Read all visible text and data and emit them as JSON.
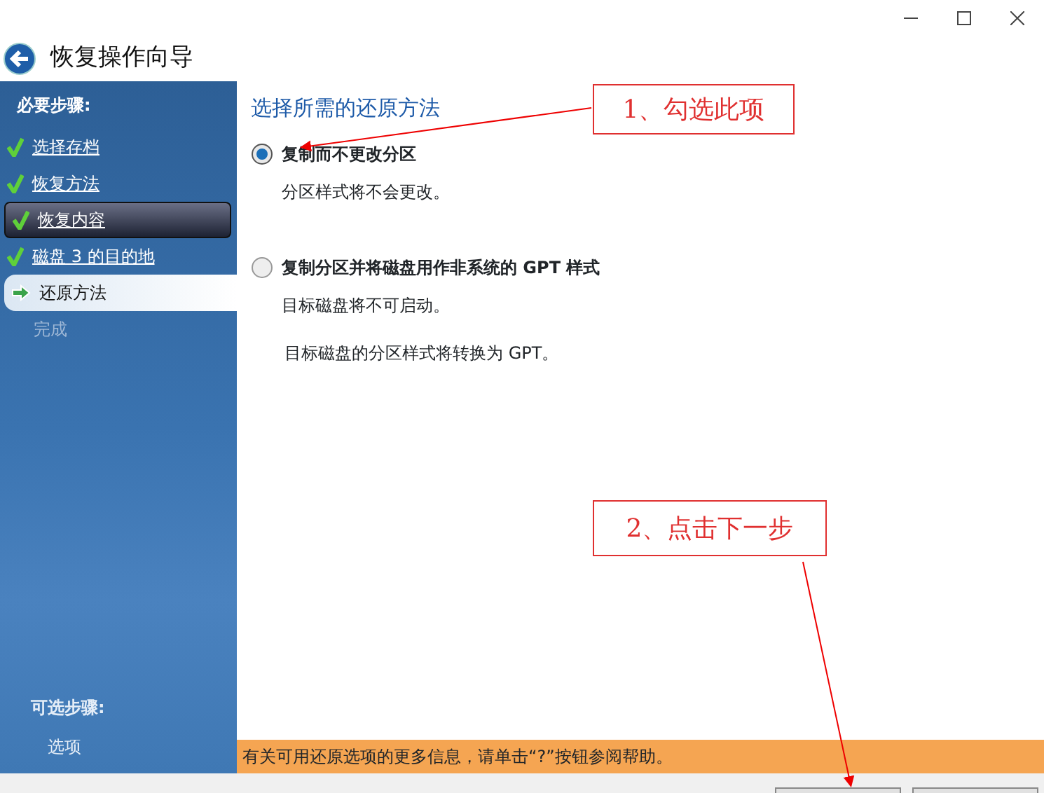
{
  "window": {
    "title": "恢复操作向导"
  },
  "sidebar": {
    "required_heading": "必要步骤:",
    "steps": [
      {
        "label": "选择存档",
        "kind": "done",
        "selected": false
      },
      {
        "label": "恢复方法",
        "kind": "done",
        "selected": false
      },
      {
        "label": "恢复内容",
        "kind": "done",
        "selected": true
      },
      {
        "label": " 磁盘 3 的目的地",
        "kind": "done",
        "selected": false
      },
      {
        "label": "还原方法",
        "kind": "current",
        "selected": false
      },
      {
        "label": "完成",
        "kind": "pending",
        "selected": false
      }
    ],
    "optional_heading": "可选步骤:",
    "optional_steps": [
      "选项"
    ]
  },
  "content": {
    "heading": "选择所需的还原方法",
    "options": [
      {
        "label": "复制而不更改分区",
        "selected": true,
        "notes": [
          "分区样式将不会更改。"
        ]
      },
      {
        "label": "复制分区并将磁盘用作非系统的 GPT 样式",
        "selected": false,
        "notes": [
          "目标磁盘将不可启动。",
          "目标磁盘的分区样式将转换为 GPT。"
        ]
      }
    ]
  },
  "info_bar": "有关可用还原选项的更多信息，请单击“?”按钮参阅帮助。",
  "annotations": [
    "1、勾选此项",
    "2、点击下一步"
  ]
}
